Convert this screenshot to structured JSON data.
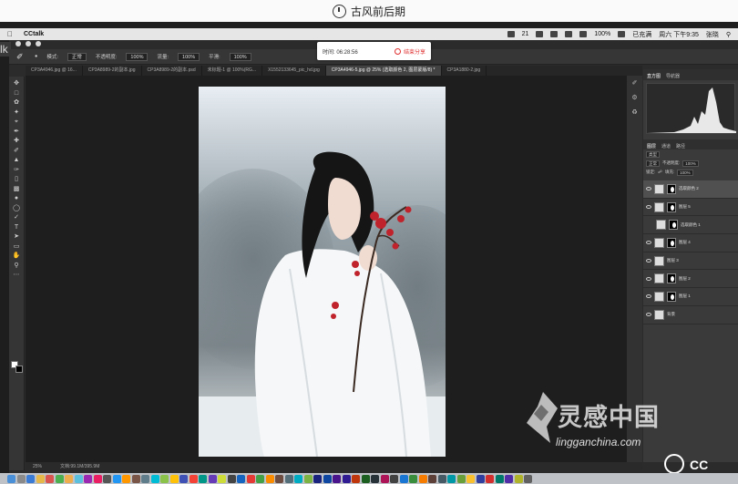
{
  "broadcast": {
    "title": "古风前后期"
  },
  "menubar": {
    "app_name": "CCtalk",
    "right_items": [
      "21",
      "100%",
      "已充满",
      "周六 下午9:35",
      "张晓"
    ]
  },
  "popup": {
    "time_label": "时间: 06:28:56",
    "stop_label": "结束分享"
  },
  "options_bar": {
    "mode_label": "模式:",
    "mode_value": "正常",
    "opacity_label": "不透明度:",
    "opacity_value": "100%",
    "flow_label": "流量:",
    "flow_value": "100%",
    "smooth_label": "平滑:",
    "smooth_value": "100%"
  },
  "doc_tabs": [
    "CP3A4946.jpg @ 16...",
    "CP3A8989-2的副本.jpg",
    "CP3A8989-2的副本.psd",
    "未标题-1 @ 100%(RG...",
    "X1552133645_pic_hd.jpg",
    "CP3A4946-5.jpg @ 25% (选取颜色 2, 图层蒙版/8) *",
    "CP3A1880-2.jpg"
  ],
  "right_panel": {
    "top_tabs": [
      "直方图",
      "导航器"
    ],
    "layer_tabs": [
      "图层",
      "通道",
      "路径"
    ],
    "kind_label": "类型",
    "blend_value": "正常",
    "opacity_label": "不透明度:",
    "opacity_value": "100%",
    "lock_label": "锁定:",
    "fill_label": "填充:",
    "fill_value": "100%",
    "layers": [
      {
        "name": "选取颜色 2",
        "mask": true,
        "selected": true
      },
      {
        "name": "图层 5",
        "mask": true,
        "selected": false
      },
      {
        "name": "选取颜色 1",
        "mask": true,
        "selected": false
      },
      {
        "name": "图层 4",
        "mask": true,
        "selected": false
      },
      {
        "name": "图层 3",
        "mask": false,
        "selected": false
      },
      {
        "name": "图层 2",
        "mask": true,
        "selected": false
      },
      {
        "name": "图层 1",
        "mask": true,
        "selected": false
      },
      {
        "name": "背景",
        "mask": false,
        "selected": false
      }
    ]
  },
  "status_bar": {
    "zoom": "25%",
    "doc_info": "文档:99.1M/395.9M"
  },
  "watermark": {
    "cn": "灵感中国",
    "en": "lingganchina.com",
    "corner": "CC"
  },
  "left_badge": "lk"
}
